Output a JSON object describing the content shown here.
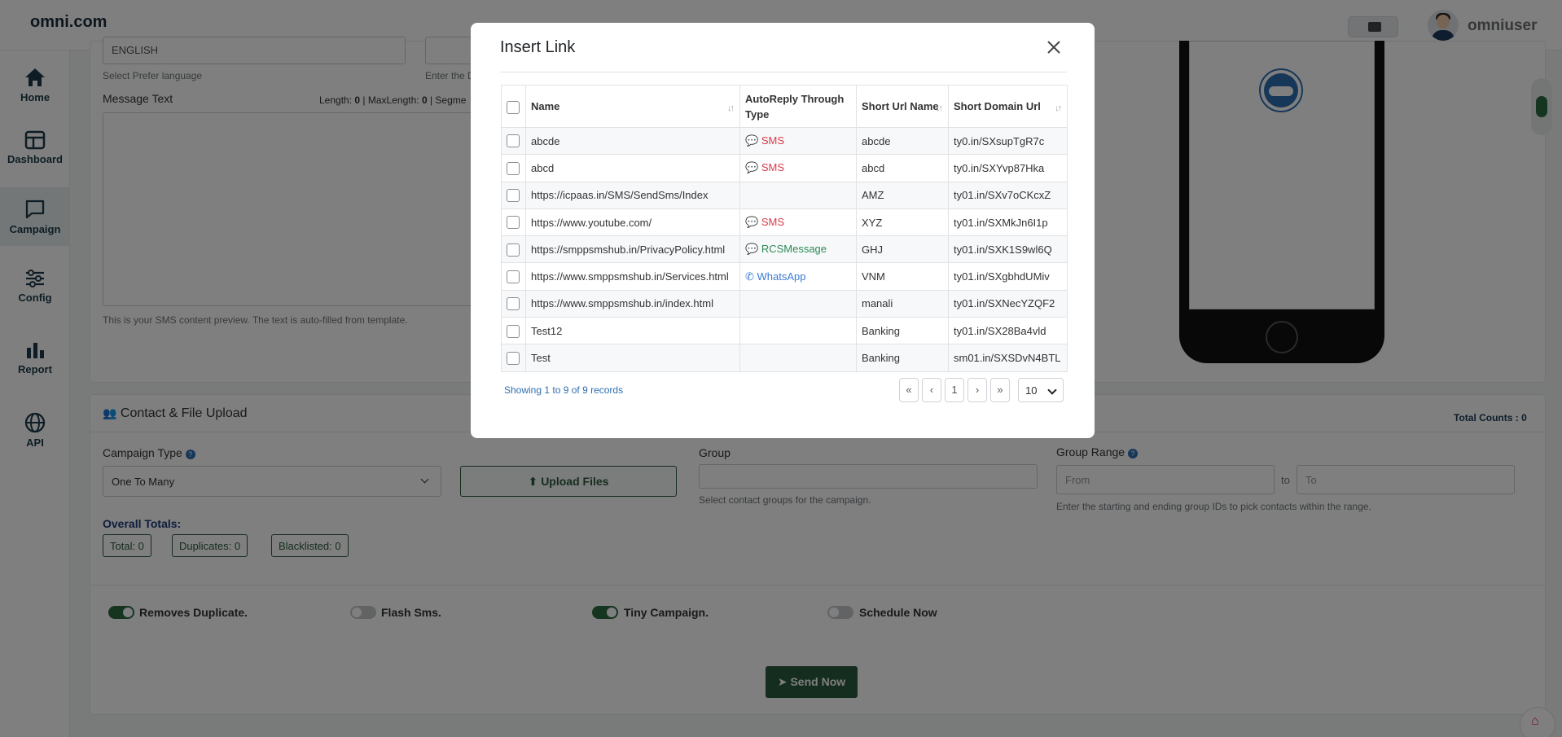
{
  "brand": "omni.com",
  "user": {
    "name": "omniuser"
  },
  "sidebar": {
    "items": [
      {
        "label": "Home"
      },
      {
        "label": "Dashboard"
      },
      {
        "label": "Campaign"
      },
      {
        "label": "Config"
      },
      {
        "label": "Report"
      },
      {
        "label": "API"
      }
    ]
  },
  "message": {
    "language_value": "ENGLISH",
    "language_help": "Select Prefer language",
    "date_help": "Enter the D",
    "label": "Message Text",
    "length_label": "Length:",
    "length_value": "0",
    "maxlength_label": "MaxLength:",
    "maxlength_value": "0",
    "segment_label": "Segme",
    "preview_help": "This is your SMS content preview. The text is auto-filled from template."
  },
  "contact": {
    "title": "Contact & File Upload",
    "total_counts_label": "Total Counts :",
    "total_counts_value": "0",
    "campaign_type_label": "Campaign Type",
    "campaign_type_value": "One To Many",
    "upload_label": "Upload Files",
    "group_label": "Group",
    "group_help": "Select contact groups for the campaign.",
    "group_range_label": "Group Range",
    "from_placeholder": "From",
    "to_text": "to",
    "to_placeholder": "To",
    "range_help": "Enter the starting and ending group IDs to pick contacts within the range.",
    "overall_label": "Overall Totals:",
    "total": "Total: 0",
    "duplicates": "Duplicates: 0",
    "blacklisted": "Blacklisted: 0"
  },
  "options": {
    "removes_duplicate": "Removes Duplicate.",
    "flash_sms": "Flash Sms.",
    "tiny_campaign": "Tiny Campaign.",
    "schedule_now": "Schedule Now"
  },
  "send_label": "Send Now",
  "modal": {
    "title": "Insert Link",
    "columns": [
      "Name",
      "AutoReply Through Type",
      "Short Url Name",
      "Short Domain Url"
    ],
    "rows": [
      {
        "name": "abcde",
        "type": "SMS",
        "type_kind": "sms",
        "short_name": "abcde",
        "short_url": "ty0.in/SXsupTgR7c"
      },
      {
        "name": "abcd",
        "type": "SMS",
        "type_kind": "sms",
        "short_name": "abcd",
        "short_url": "ty0.in/SXYvp87Hka"
      },
      {
        "name": "https://icpaas.in/SMS/SendSms/Index",
        "type": "",
        "type_kind": "",
        "short_name": "AMZ",
        "short_url": "ty01.in/SXv7oCKcxZ"
      },
      {
        "name": "https://www.youtube.com/",
        "type": "SMS",
        "type_kind": "sms",
        "short_name": "XYZ",
        "short_url": "ty01.in/SXMkJn6I1p"
      },
      {
        "name": "https://smppsmshub.in/PrivacyPolicy.html",
        "type": "RCSMessage",
        "type_kind": "rcs",
        "short_name": "GHJ",
        "short_url": "ty01.in/SXK1S9wl6Q"
      },
      {
        "name": "https://www.smppsmshub.in/Services.html",
        "type": "WhatsApp",
        "type_kind": "wa",
        "short_name": "VNM",
        "short_url": "ty01.in/SXgbhdUMiv"
      },
      {
        "name": "https://www.smppsmshub.in/index.html",
        "type": "",
        "type_kind": "",
        "short_name": "manali",
        "short_url": "ty01.in/SXNecYZQF2"
      },
      {
        "name": "Test12",
        "type": "",
        "type_kind": "",
        "short_name": "Banking",
        "short_url": "ty01.in/SX28Ba4vld"
      },
      {
        "name": "Test",
        "type": "",
        "type_kind": "",
        "short_name": "Banking",
        "short_url": "sm01.in/SXSDvN4BTL"
      }
    ],
    "records_text": "Showing 1 to 9 of 9 records",
    "pagination": {
      "first": "«",
      "prev": "‹",
      "page": "1",
      "next": "›",
      "last": "»",
      "page_size": "10"
    }
  },
  "colors": {
    "brand_green": "#2a5a3d",
    "sms": "#d9394b",
    "rcs": "#2e8b57",
    "whatsapp": "#3a7bd5",
    "link_blue": "#2f6fb2"
  }
}
